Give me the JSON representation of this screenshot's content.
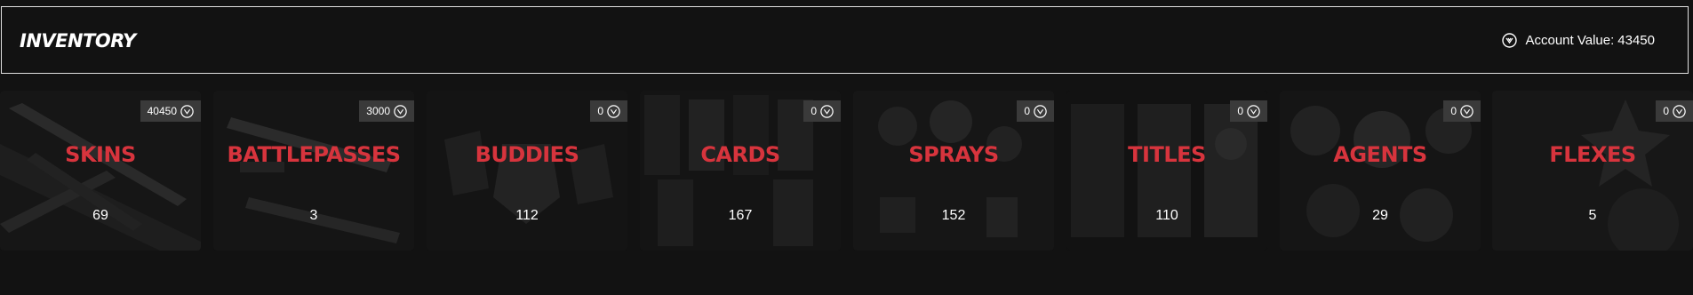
{
  "header": {
    "title": "INVENTORY",
    "account_label": "Account Value:",
    "account_value": "43450",
    "currency_icon": "valorant-points-icon"
  },
  "colors": {
    "background": "#121212",
    "title_red": "#d7343d",
    "badge_bg": "#3a3a3a"
  },
  "cards": [
    {
      "title": "SKINS",
      "count": "69",
      "value": "40450"
    },
    {
      "title": "BATTLEPASSES",
      "count": "3",
      "value": "3000"
    },
    {
      "title": "BUDDIES",
      "count": "112",
      "value": "0"
    },
    {
      "title": "CARDS",
      "count": "167",
      "value": "0"
    },
    {
      "title": "SPRAYS",
      "count": "152",
      "value": "0"
    },
    {
      "title": "TITLES",
      "count": "110",
      "value": "0"
    },
    {
      "title": "AGENTS",
      "count": "29",
      "value": "0"
    },
    {
      "title": "FLEXES",
      "count": "5",
      "value": "0"
    }
  ]
}
